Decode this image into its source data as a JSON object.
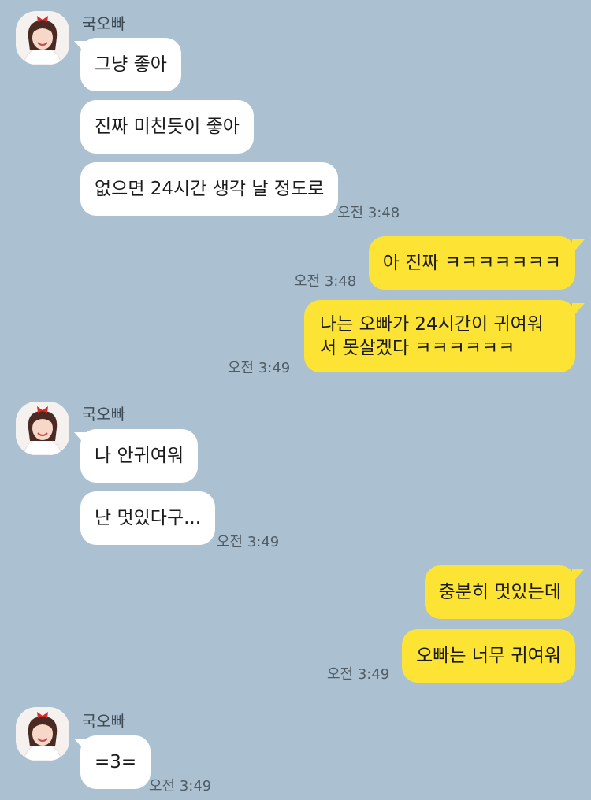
{
  "chat": {
    "groups": [
      {
        "sender": "국오빠",
        "messages": [
          "그냥 좋아",
          "진짜 미친듯이 좋아",
          "없으면 24시간 생각 날 정도로"
        ],
        "time": "오전 3:48"
      },
      {
        "sender": "me",
        "messages": [
          "아 진짜 ㅋㅋㅋㅋㅋㅋㅋ"
        ],
        "time": "오전 3:48"
      },
      {
        "sender": "me",
        "messages": [
          "나는 오빠가 24시간이 귀여워서 못살겠다 ㅋㅋㅋㅋㅋㅋ"
        ],
        "time": "오전 3:49"
      },
      {
        "sender": "국오빠",
        "messages": [
          "나 안귀여워",
          "난 멋있다구..."
        ],
        "time": "오전 3:49"
      },
      {
        "sender": "me",
        "messages": [
          "충분히 멋있는데",
          "오빠는 너무 귀여워"
        ],
        "time": "오전 3:49"
      },
      {
        "sender": "국오빠",
        "messages": [
          "=3="
        ],
        "time": "오전 3:49"
      }
    ]
  },
  "colors": {
    "background": "#abc1d1",
    "incoming_bubble": "#ffffff",
    "outgoing_bubble": "#fde434"
  },
  "icons": {
    "avatar": "profile-photo"
  }
}
